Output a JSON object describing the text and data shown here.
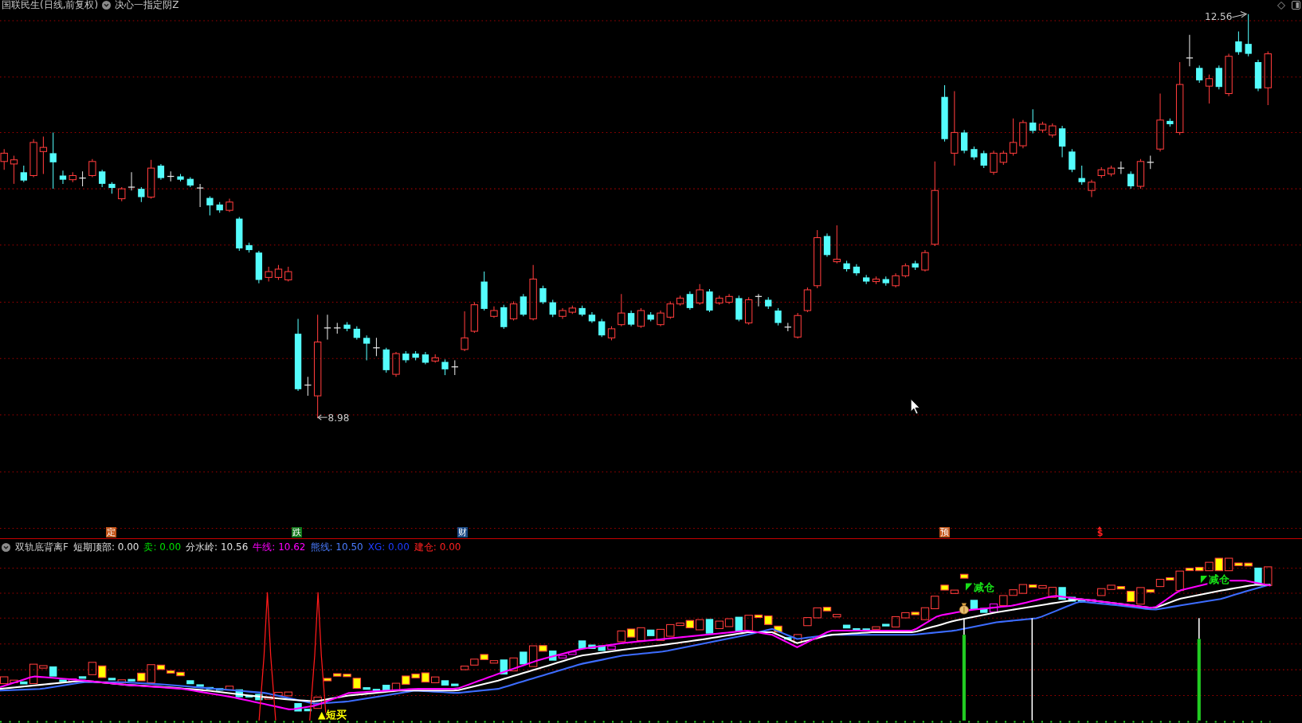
{
  "header": {
    "security": "国联民生(日线,前复权)",
    "formula": "决心一指定阴Z"
  },
  "price_chart": {
    "high_label": "12.56",
    "low_label": "8.98"
  },
  "event_markers": [
    {
      "label": "定",
      "kind": "tag",
      "color": "#c4561a"
    },
    {
      "label": "跌",
      "kind": "tag",
      "color": "#12781c"
    },
    {
      "label": "财",
      "kind": "tag",
      "color": "#1c4a86"
    },
    {
      "label": "预",
      "kind": "tag",
      "color": "#c4561a"
    },
    {
      "label": "$",
      "kind": "arrow",
      "color": "#ff2020"
    }
  ],
  "indicator": {
    "name": "双轨底背离F",
    "readouts": [
      {
        "label": "短期顶部:",
        "value": "0.00",
        "color": "#e0e0e0"
      },
      {
        "label": "卖:",
        "value": "0.00",
        "color": "#00e000"
      },
      {
        "label": "分水岭:",
        "value": "10.56",
        "color": "#e0e0e0"
      },
      {
        "label": "牛线:",
        "value": "10.62",
        "color": "#ff00ff"
      },
      {
        "label": "熊线:",
        "value": "10.50",
        "color": "#4a7cff"
      },
      {
        "label": "XG:",
        "value": "0.00",
        "color": "#1e3cff"
      },
      {
        "label": "建仓:",
        "value": "0.00",
        "color": "#ff2020"
      }
    ],
    "signals": [
      {
        "label": "减仓",
        "kind": "flag",
        "color": "#18e018"
      },
      {
        "label": "减仓",
        "kind": "flag",
        "color": "#18e018"
      },
      {
        "label": "▲短买",
        "kind": "plain",
        "color": "#ffff00"
      }
    ]
  }
}
